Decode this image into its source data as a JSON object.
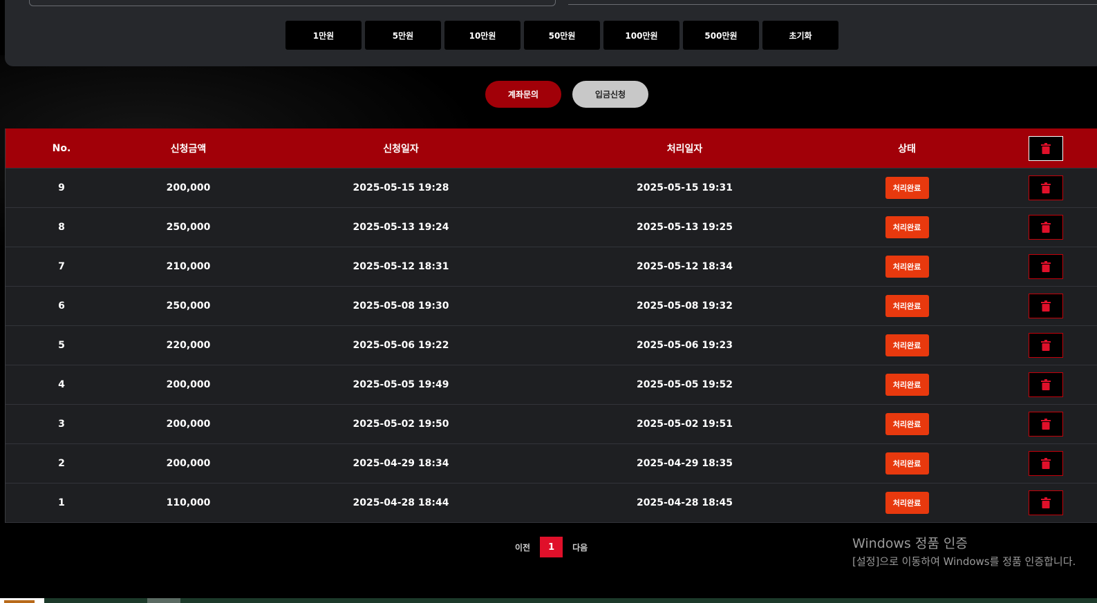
{
  "amount_buttons": [
    "1만원",
    "5만원",
    "10만원",
    "50만원",
    "100만원",
    "500만원",
    "초기화"
  ],
  "actions": {
    "account_inquiry": "계좌문의",
    "deposit_request": "입금신청"
  },
  "table": {
    "headers": {
      "no": "No.",
      "amount": "신청금액",
      "request_date": "신청일자",
      "process_date": "처리일자",
      "status": "상태"
    },
    "rows": [
      {
        "no": "9",
        "amount": "200,000",
        "request_date": "2025-05-15 19:28",
        "process_date": "2025-05-15 19:31",
        "status": "처리완료"
      },
      {
        "no": "8",
        "amount": "250,000",
        "request_date": "2025-05-13 19:24",
        "process_date": "2025-05-13 19:25",
        "status": "처리완료"
      },
      {
        "no": "7",
        "amount": "210,000",
        "request_date": "2025-05-12 18:31",
        "process_date": "2025-05-12 18:34",
        "status": "처리완료"
      },
      {
        "no": "6",
        "amount": "250,000",
        "request_date": "2025-05-08 19:30",
        "process_date": "2025-05-08 19:32",
        "status": "처리완료"
      },
      {
        "no": "5",
        "amount": "220,000",
        "request_date": "2025-05-06 19:22",
        "process_date": "2025-05-06 19:23",
        "status": "처리완료"
      },
      {
        "no": "4",
        "amount": "200,000",
        "request_date": "2025-05-05 19:49",
        "process_date": "2025-05-05 19:52",
        "status": "처리완료"
      },
      {
        "no": "3",
        "amount": "200,000",
        "request_date": "2025-05-02 19:50",
        "process_date": "2025-05-02 19:51",
        "status": "처리완료"
      },
      {
        "no": "2",
        "amount": "200,000",
        "request_date": "2025-04-29 18:34",
        "process_date": "2025-04-29 18:35",
        "status": "처리완료"
      },
      {
        "no": "1",
        "amount": "110,000",
        "request_date": "2025-04-28 18:44",
        "process_date": "2025-04-28 18:45",
        "status": "처리완료"
      }
    ]
  },
  "pagination": {
    "prev": "이전",
    "current": "1",
    "next": "다음"
  },
  "watermark": {
    "title": "Windows 정품 인증",
    "subtitle": "[설정]으로 이동하여 Windows를 정품 인증합니다."
  },
  "icons": {
    "delete": "trash-icon"
  },
  "colors": {
    "header_red": "#a10008",
    "status_orange": "#e8390e",
    "page_active": "#e0102a",
    "row_bg": "#1e1f22",
    "panel_bg": "#26282c"
  }
}
